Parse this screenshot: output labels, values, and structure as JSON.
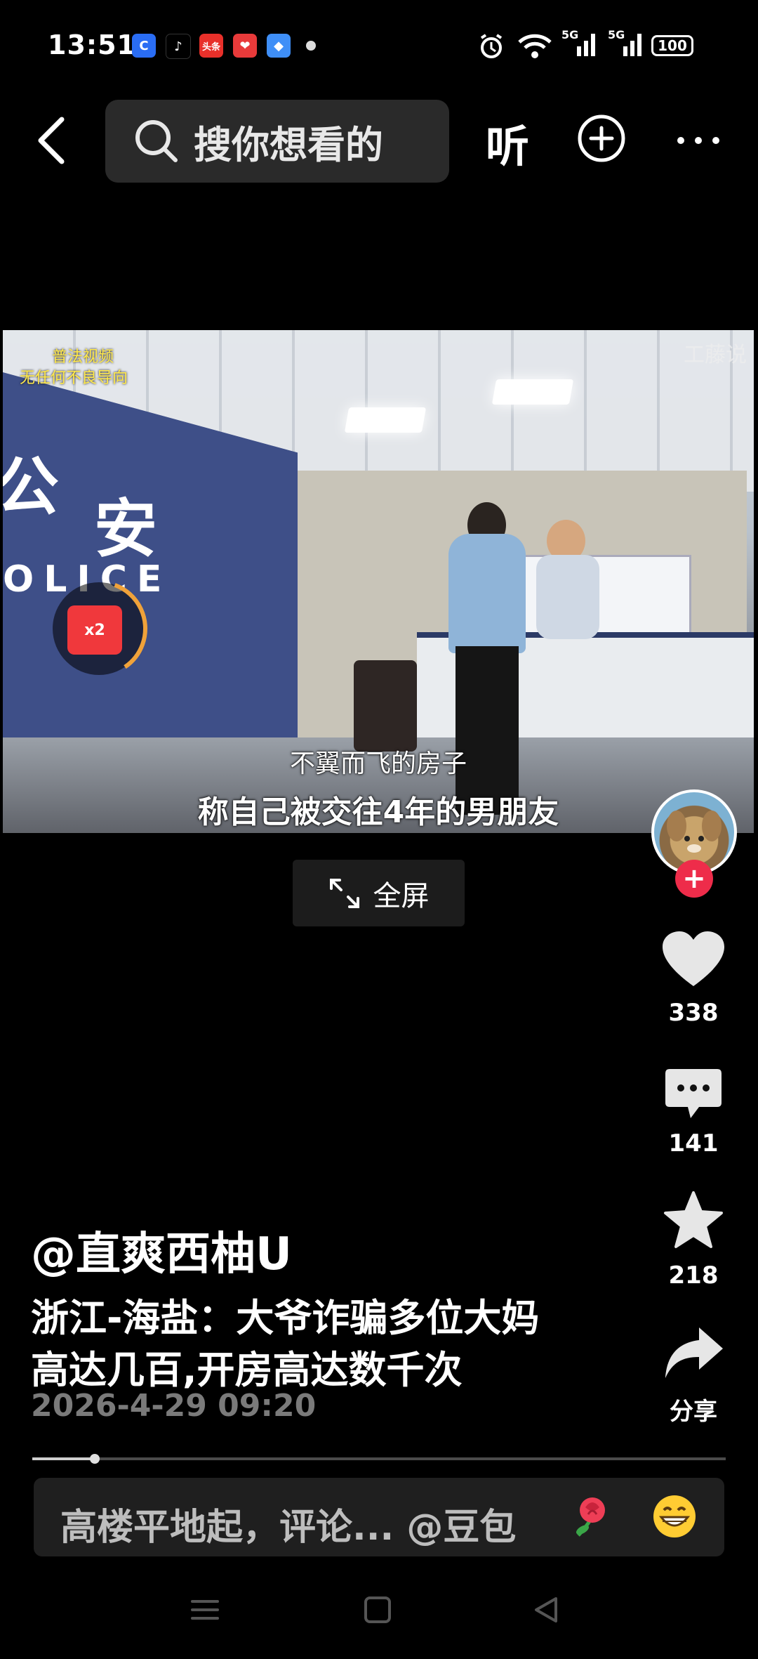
{
  "status_bar": {
    "time": "13:51",
    "apps": [
      {
        "name": "c-app-icon",
        "glyph": "C",
        "color": "#2a6df4"
      },
      {
        "name": "tiktok-icon",
        "glyph": "♪",
        "color": "#000000"
      },
      {
        "name": "toutiao-icon",
        "glyph": "头条",
        "color": "#e8302a"
      },
      {
        "name": "heart-app-icon",
        "glyph": "❤",
        "color": "#e83a3a"
      },
      {
        "name": "blue-app-icon",
        "glyph": "◆",
        "color": "#3f8ff7"
      }
    ],
    "network_1": "5G",
    "network_2": "5G",
    "battery": "100"
  },
  "nav": {
    "search_placeholder": "搜你想看的",
    "listen_label": "听"
  },
  "video": {
    "watermark_left_1": "普法视频",
    "watermark_left_2": "无任何不良导向",
    "watermark_right": "工藤说",
    "sign_char_1": "公",
    "sign_char_2": "安",
    "sign_police": "OLICE",
    "subtitle_1": "不翼而飞的房子",
    "subtitle_2": "称自己被交往4年的男朋友",
    "redpacket_multiplier": "x2",
    "redpacket_progress": 0.35
  },
  "fullscreen_label": "全屏",
  "rail": {
    "likes": "338",
    "comments": "141",
    "favorites": "218",
    "share_label": "分享"
  },
  "caption": {
    "author": "@直爽西柚U",
    "title_line1": "浙江-海盐：大爷诈骗多位大妈",
    "title_line2": "高达几百,开房高达数千次",
    "timestamp": "2026-4-29 09:20"
  },
  "progress": 0.09,
  "comment_bar": {
    "placeholder": "高楼平地起，评论... @豆包"
  },
  "colors": {
    "accent_red": "#ee2c4a",
    "background": "#000000"
  }
}
